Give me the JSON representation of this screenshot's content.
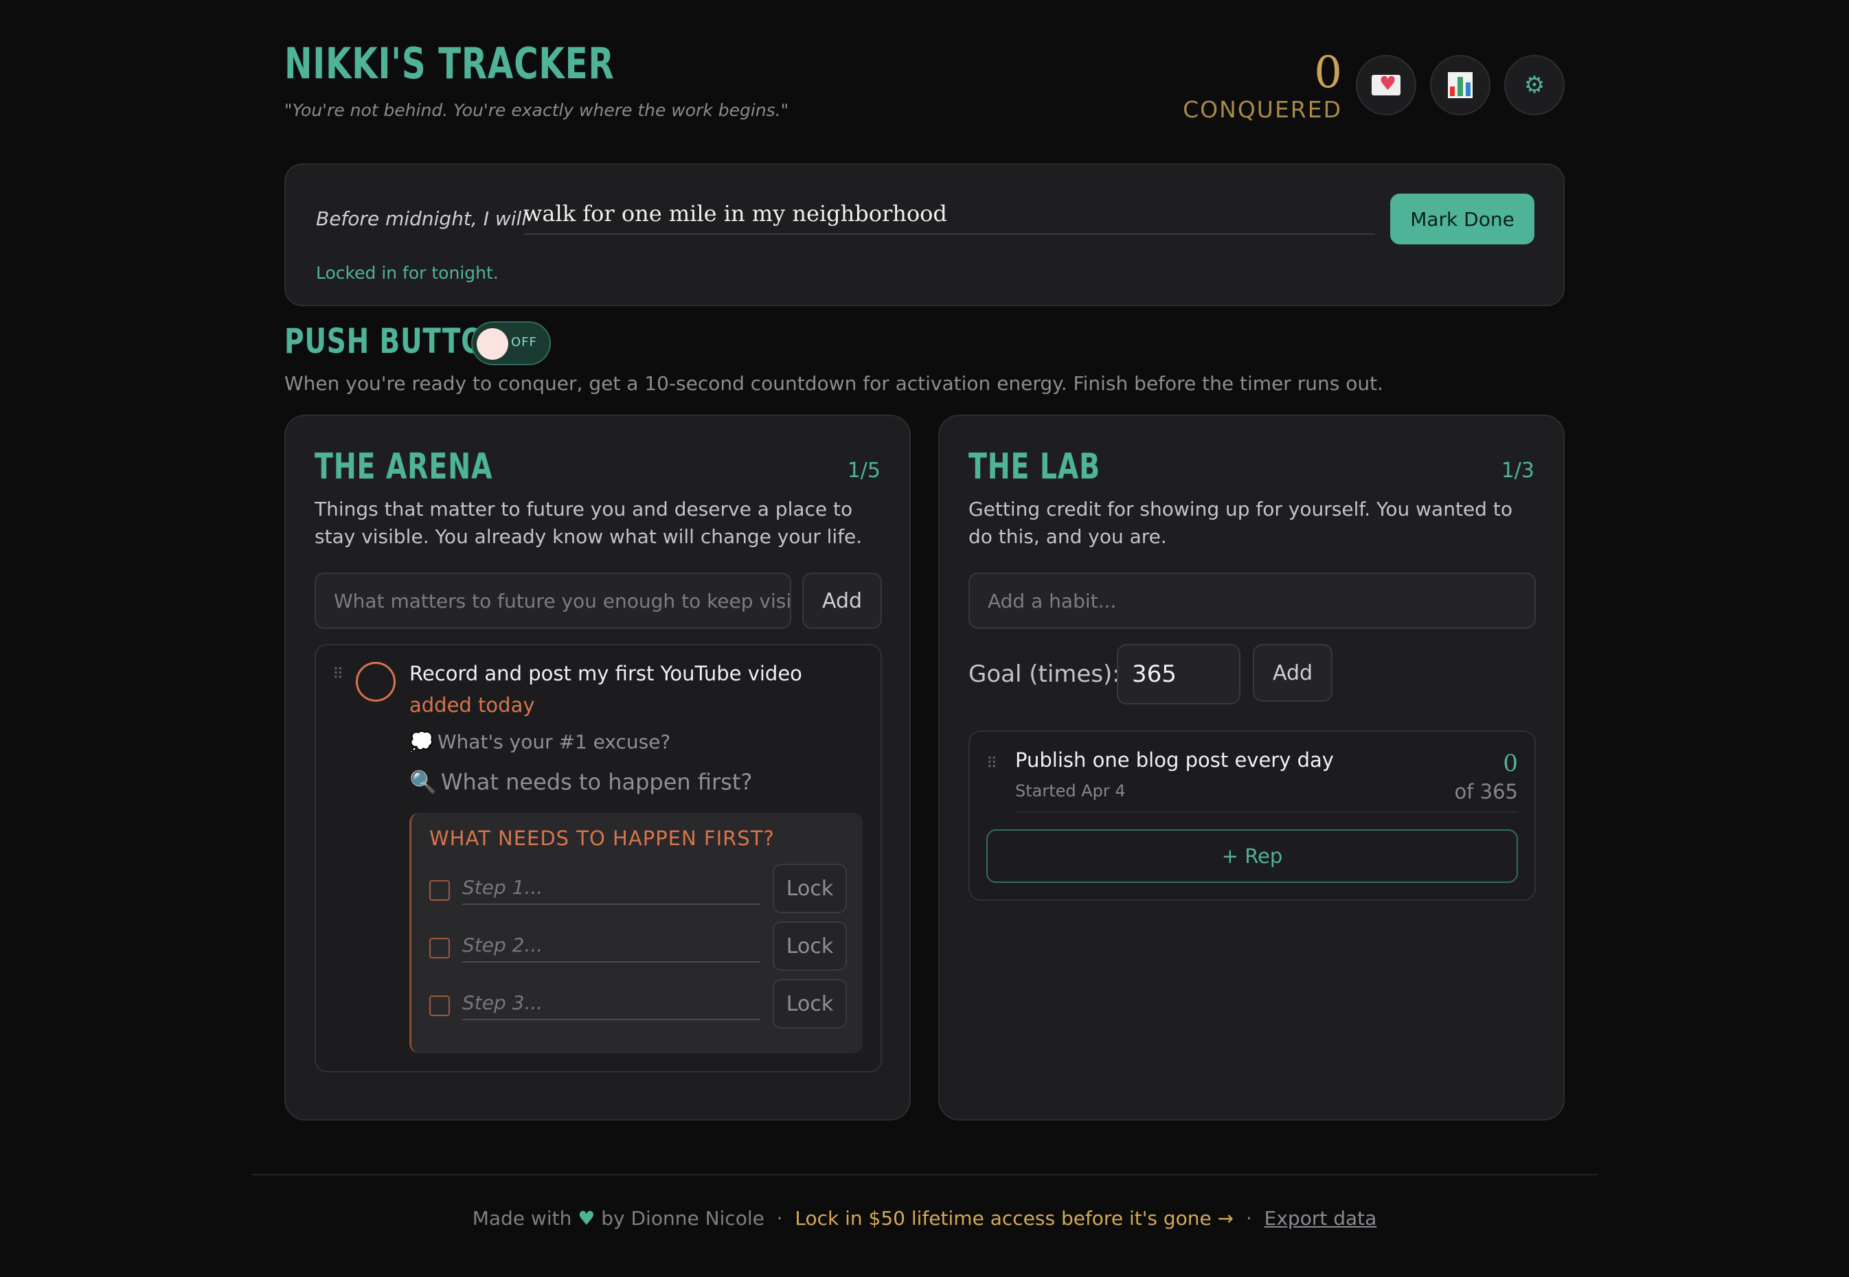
{
  "header": {
    "title": "NIKKI'S TRACKER",
    "tagline": "\"You're not behind. You're exactly where the work begins.\"",
    "conquered_count": "0",
    "conquered_label": "CONQUERED",
    "icons": [
      "love-letter-icon",
      "bar-chart-icon",
      "gear-icon"
    ],
    "gear_glyph": "⚙"
  },
  "commitment": {
    "prefix": "Before midnight, I will",
    "goal": "walk for one mile in my neighborhood",
    "button": "Mark Done",
    "status": "Locked in for tonight."
  },
  "push": {
    "title": "PUSH BUTTON",
    "toggle_state": "OFF",
    "description": "When you're ready to conquer, get a 10-second countdown for activation energy. Finish before the timer runs out."
  },
  "arena": {
    "title": "THE ARENA",
    "count": "1/5",
    "description": "Things that matter to future you and deserve a place to stay visible. You already know what will change your life.",
    "input_placeholder": "What matters to future you enough to keep visible?",
    "add_label": "Add",
    "task": {
      "title": "Record and post my first YouTube video",
      "added": "added today",
      "excuse_prompt": "What's your #1 excuse?",
      "first_prompt": "What needs to happen first?",
      "steps_heading": "WHAT NEEDS TO HAPPEN FIRST?",
      "steps": [
        {
          "placeholder": "Step 1...",
          "lock": "Lock"
        },
        {
          "placeholder": "Step 2...",
          "lock": "Lock"
        },
        {
          "placeholder": "Step 3...",
          "lock": "Lock"
        }
      ]
    }
  },
  "lab": {
    "title": "THE LAB",
    "count": "1/3",
    "description": "Getting credit for showing up for yourself. You wanted to do this, and you are.",
    "input_placeholder": "Add a habit...",
    "goal_label": "Goal (times):",
    "goal_value": "365",
    "add_label": "Add",
    "habit": {
      "title": "Publish one blog post every day",
      "started": "Started Apr 4",
      "count": "0",
      "of": "of 365",
      "rep_label": "+ Rep"
    }
  },
  "footer": {
    "made_with": "Made with",
    "heart": "♥",
    "by": "by Dionne Nicole",
    "sep": "·",
    "promo": "Lock in $50 lifetime access before it's gone →",
    "export": "Export data"
  },
  "colors": {
    "accent": "#4fb397",
    "gold": "#c7a257",
    "orange": "#d9744a",
    "background": "#0c0c0d",
    "card": "#1e1e21"
  }
}
